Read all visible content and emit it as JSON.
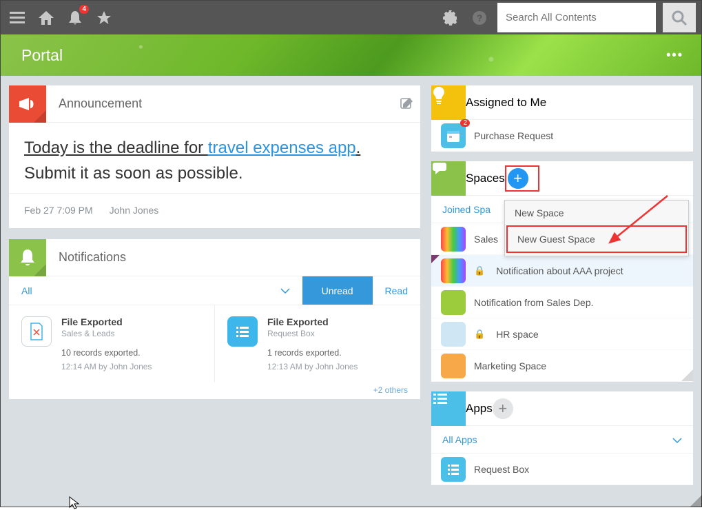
{
  "topbar": {
    "notification_count": "4",
    "search_placeholder": "Search All Contents"
  },
  "hero": {
    "title": "Portal"
  },
  "announcement": {
    "panel_title": "Announcement",
    "prefix": "Today is the deadline for ",
    "link": "travel expenses app",
    "suffix": ".",
    "line2": "Submit it as soon as possible.",
    "timestamp": "Feb 27 7:09 PM",
    "author": "John Jones"
  },
  "notifications": {
    "panel_title": "Notifications",
    "tabs": {
      "all": "All",
      "unread": "Unread",
      "read": "Read"
    },
    "cards": [
      {
        "title": "File Exported",
        "sub": "Sales & Leads",
        "msg": "10 records exported.",
        "meta": "12:14 AM  by John Jones"
      },
      {
        "title": "File Exported",
        "sub": "Request Box",
        "msg": "1 records exported.",
        "meta": "12:13 AM  by John Jones"
      }
    ],
    "others": "+2 others"
  },
  "assigned": {
    "panel_title": "Assigned to Me",
    "item_label": "Purchase Request",
    "item_badge": "2"
  },
  "spaces": {
    "panel_title": "Spaces",
    "tab": "Joined Spa",
    "items": [
      {
        "label": "Sales"
      },
      {
        "label": "Notification about AAA project",
        "locked": true
      },
      {
        "label": "Notification from Sales Dep."
      },
      {
        "label": "HR space",
        "locked": true
      },
      {
        "label": "Marketing Space"
      }
    ],
    "menu": {
      "new_space": "New Space",
      "new_guest": "New Guest Space"
    }
  },
  "apps": {
    "panel_title": "Apps",
    "tab": "All Apps",
    "item": "Request Box"
  }
}
